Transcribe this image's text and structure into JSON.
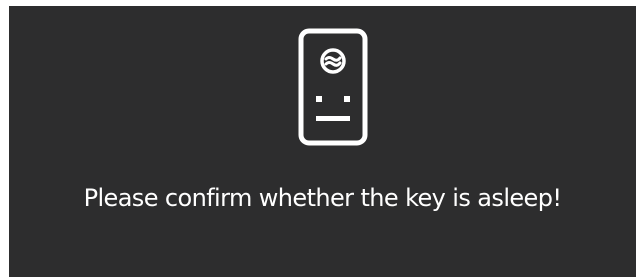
{
  "dialog": {
    "icon": "sleeping-key-device-icon",
    "message": "Please confirm whether the key is asleep!",
    "background_color": "#2d2d2e",
    "text_color": "#ffffff"
  }
}
